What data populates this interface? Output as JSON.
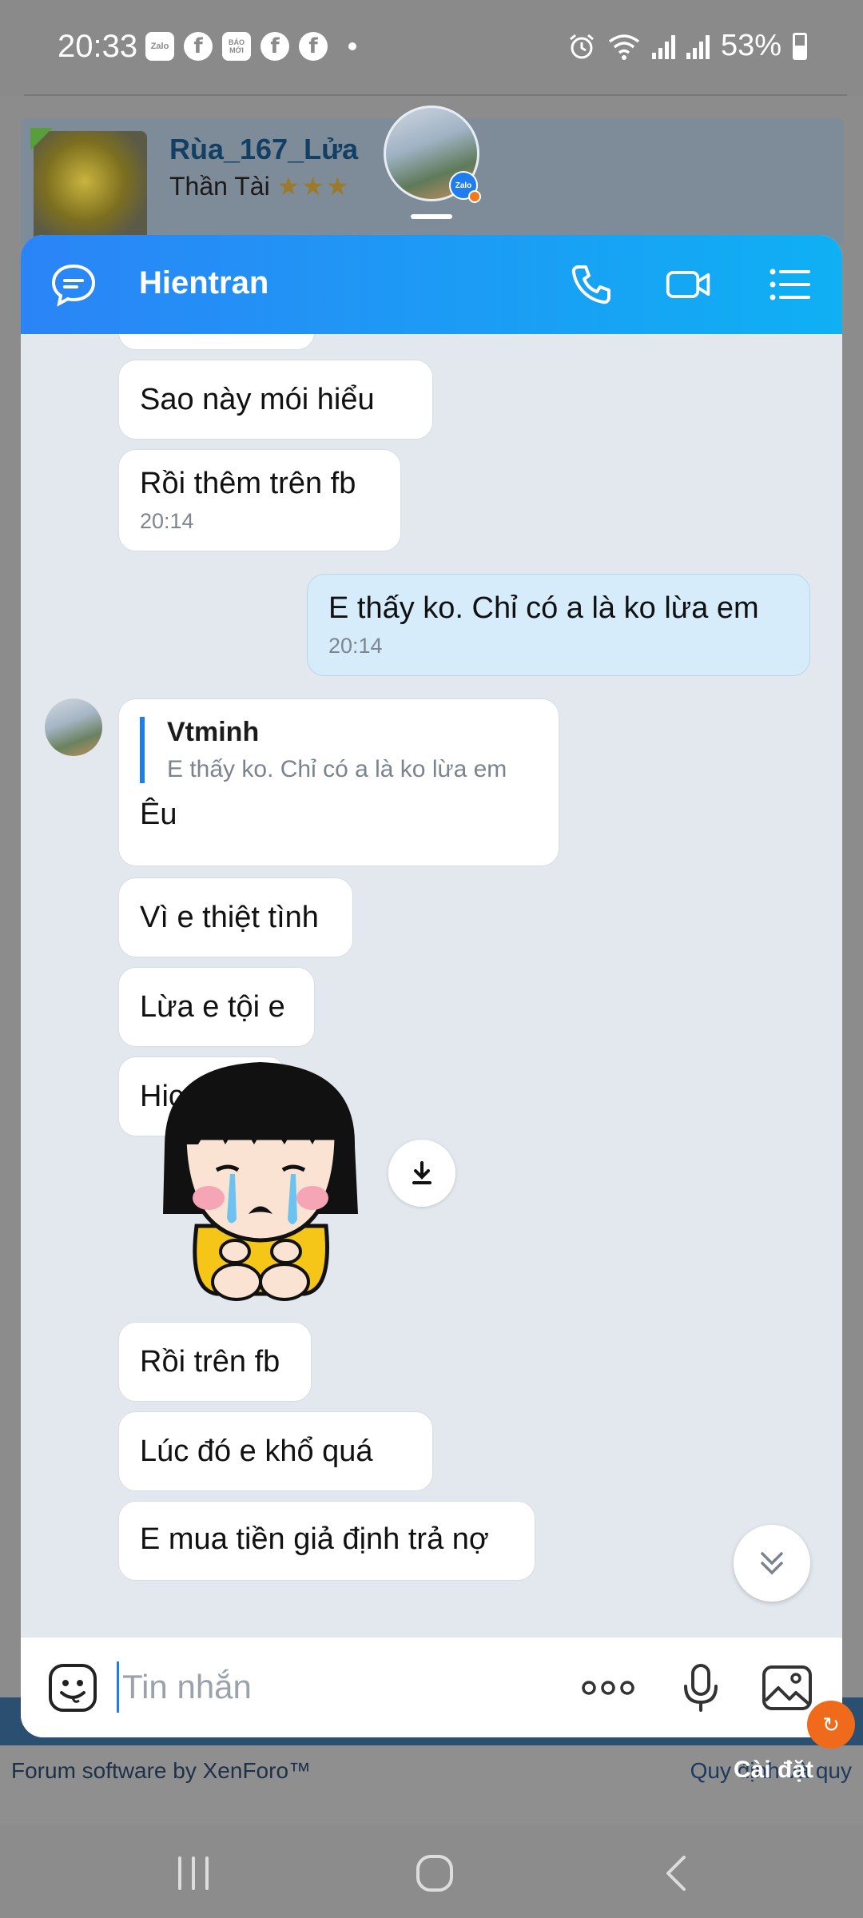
{
  "status_bar": {
    "time": "20:33",
    "apps": [
      "Zalo",
      "f",
      "BÁO MỚI",
      "f",
      "f"
    ],
    "battery": "53%"
  },
  "background_page": {
    "username": "Rùa_167_Lửa",
    "user_title": "Thần Tài",
    "user_stars": "★★★",
    "footer_left": "Forum software by XenForo™",
    "footer_right": "Quy định và quy",
    "settings_label": "Cài đặt"
  },
  "bubble_head": {
    "badge": "Zalo"
  },
  "chat": {
    "header": {
      "title": "Hientran",
      "icons": [
        "chat-icon",
        "phone-icon",
        "video-icon",
        "menu-icon"
      ]
    },
    "messages": [
      {
        "text": "Sao này mói hiểu",
        "direction": "in"
      },
      {
        "text": "Rồi thêm trên fb",
        "time": "20:14",
        "direction": "in"
      },
      {
        "text": "E thấy ko. Chỉ có a là ko lừa em",
        "time": "20:14",
        "direction": "out"
      },
      {
        "quote_name": "Vtminh",
        "quote_text": "E thấy ko. Chỉ có a là ko lừa em",
        "text": "Êu",
        "direction": "in"
      },
      {
        "text": "Vì e thiệt tình",
        "direction": "in"
      },
      {
        "text": "Lừa e tội e",
        "direction": "in"
      },
      {
        "text": "Hic",
        "direction": "in"
      },
      {
        "text": "Rồi trên fb",
        "direction": "in"
      },
      {
        "text": "Lúc đó e khổ quá",
        "direction": "in"
      },
      {
        "text": "E mua tiền giả định trả nợ",
        "direction": "in"
      }
    ],
    "input": {
      "placeholder": "Tin nhắn",
      "value": ""
    }
  },
  "colors": {
    "header_gradient_start": "#2b84f6",
    "header_gradient_end": "#0fb0f4",
    "chat_background": "#e3e8ee",
    "outgoing_bubble": "#d6ecfb",
    "accent": "#1d7ef0"
  }
}
